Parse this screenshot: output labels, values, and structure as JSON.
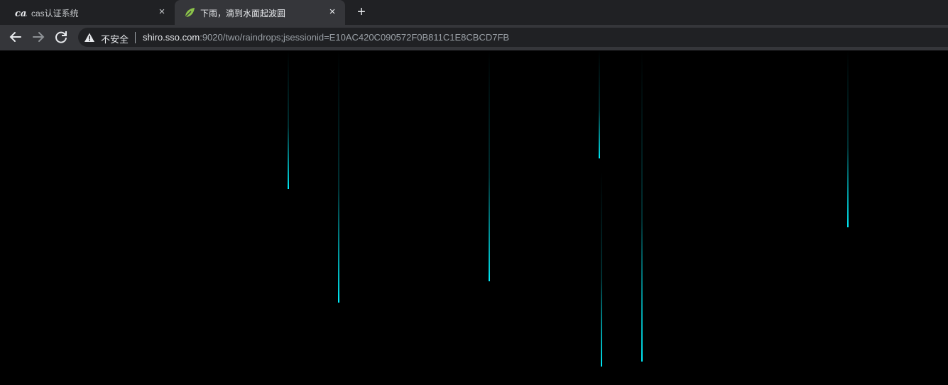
{
  "tabs": [
    {
      "title": "cas认证系统",
      "icon": "cas-logo-icon",
      "close": "×",
      "active": false
    },
    {
      "title": "下雨，滴到水面起波圆",
      "icon": "spring-leaf-icon",
      "close": "×",
      "active": true
    }
  ],
  "new_tab": "+",
  "toolbar": {
    "back": "arrow-left-icon",
    "forward": "arrow-right-icon",
    "reload": "reload-icon",
    "security_label": "不安全",
    "url_host": "shiro.sso.com",
    "url_rest": ":9020/two/raindrops;jsessionid=E10AC420C090572F0B811C1E8CBCD7FB"
  },
  "raindrops_color": "#00e5ee",
  "page_background": "#000000"
}
